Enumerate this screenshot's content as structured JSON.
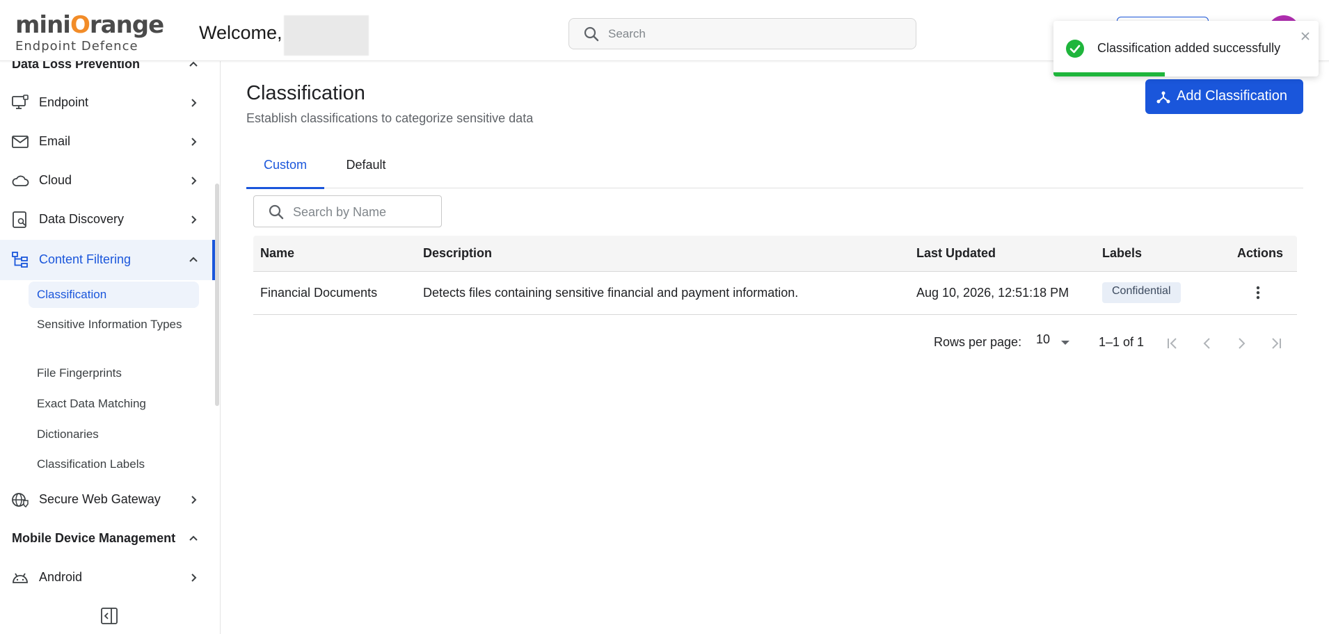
{
  "header": {
    "logo_main_1": "mini",
    "logo_main_2": "range",
    "logo_sub": "Endpoint Defence",
    "welcome": "Welcome,",
    "search_placeholder": "Search"
  },
  "sidebar": {
    "section_dlp": "Data Loss Prevention",
    "items": [
      {
        "label": "Endpoint",
        "icon": "endpoint-icon"
      },
      {
        "label": "Email",
        "icon": "mail-icon"
      },
      {
        "label": "Cloud",
        "icon": "cloud-icon"
      },
      {
        "label": "Data Discovery",
        "icon": "data-discovery-icon"
      },
      {
        "label": "Content Filtering",
        "icon": "content-filtering-icon"
      }
    ],
    "sub_items": [
      "Classification",
      "Sensitive Information Types",
      "File Fingerprints",
      "Exact Data Matching",
      "Dictionaries",
      "Classification Labels"
    ],
    "swg": "Secure Web Gateway",
    "section_mdm": "Mobile Device Management",
    "android": "Android"
  },
  "main": {
    "title": "Classification",
    "subtitle": "Establish classifications to categorize sensitive data",
    "add_button": "Add Classification",
    "tabs": [
      "Custom",
      "Default"
    ],
    "search_placeholder": "Search by Name",
    "table": {
      "headers": [
        "Name",
        "Description",
        "Last Updated",
        "Labels",
        "Actions"
      ],
      "rows": [
        {
          "name": "Financial Documents",
          "description": "Detects files containing sensitive financial and payment information.",
          "last_updated": "Aug 10, 2026, 12:51:18 PM",
          "label": "Confidential"
        }
      ]
    },
    "pagination": {
      "rows_per_page_label": "Rows per page:",
      "rows_per_page": "10",
      "range": "1–1 of 1"
    }
  },
  "toast": {
    "message": "Classification added successfully",
    "progress": 0.42,
    "progress_color": "#1fb53c"
  },
  "colors": {
    "accent": "#1a56db",
    "logo_orange": "#f28c28",
    "avatar": "#b02eb0"
  }
}
